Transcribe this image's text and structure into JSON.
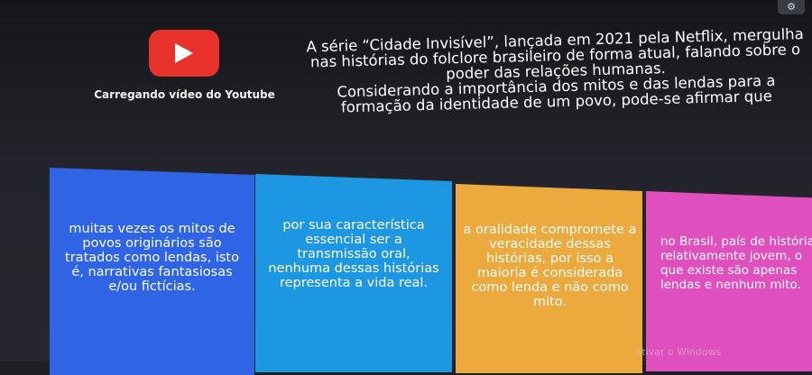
{
  "video": {
    "caption": "Carregando vídeo do Youtube",
    "logo_icon": "youtube-play-icon"
  },
  "toolbar": {
    "settings_icon": "⚙"
  },
  "question": {
    "text": "A série “Cidade Invisível”, lançada em 2021 pela Netflix, mergulha\nnas histórias do folclore brasileiro de forma atual, falando sobre o\npoder das relações humanas.\nConsiderando a importância dos mitos e das lendas para a\nformação da identidade de um povo, pode-se afirmar que"
  },
  "answers": [
    {
      "text": "muitas vezes os mitos de\npovos originários são\ntratados como lendas, isto\né, narrativas fantasiosas\ne/ou fictícias.",
      "color": "#2f64e4"
    },
    {
      "text": "por sua característica\nessencial ser a\ntransmissão oral,\nnenhuma dessas histórias\nrepresenta a vida real.",
      "color": "#1e97e3"
    },
    {
      "text": "a oralidade compromete a\nveracidade dessas\nhistórias, por isso a\nmaioria é considerada\ncomo lenda e não como\nmito.",
      "color": "#eba93e"
    },
    {
      "text": "no Brasil, país de história\nrelativamente jovem, o\nque existe são apenas\nlendas e nenhum mito.",
      "color": "#e04fbe"
    }
  ],
  "system": {
    "watermark": "Ativar o Windows"
  }
}
